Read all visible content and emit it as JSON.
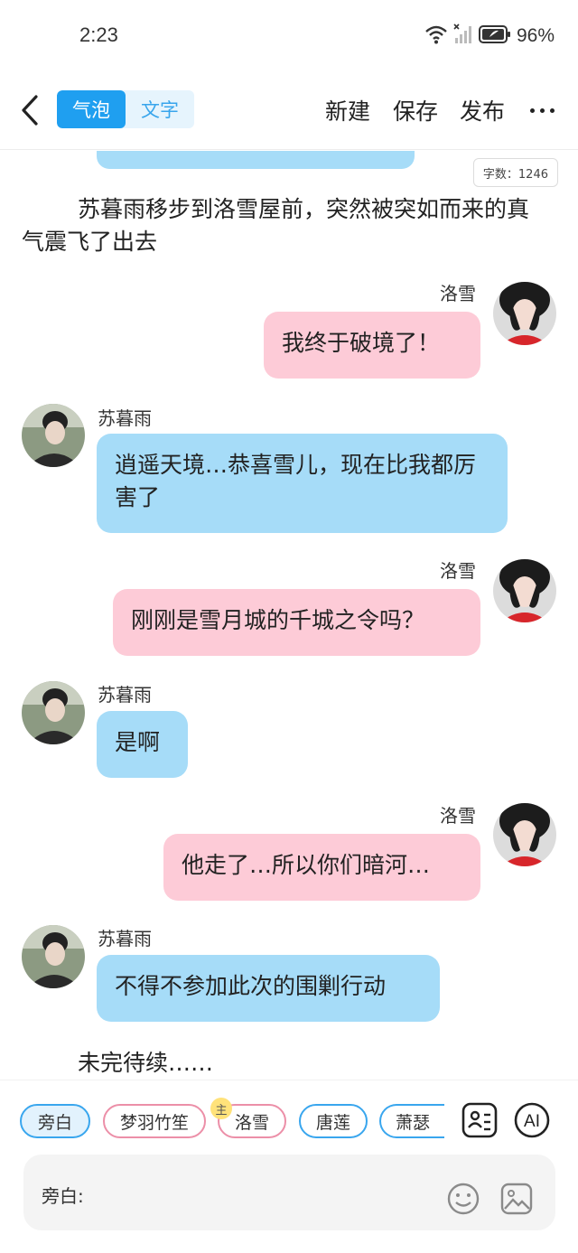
{
  "status_bar": {
    "time": "2:23",
    "battery": "96%"
  },
  "header": {
    "segments": [
      "气泡",
      "文字"
    ],
    "actions": {
      "new": "新建",
      "save": "保存",
      "publish": "发布"
    }
  },
  "chat": {
    "word_count": "字数：1246",
    "narration_1": "苏暮雨移步到洛雪屋前，突然被突如而来的真气震飞了出去",
    "messages": [
      {
        "speaker": "洛雪",
        "side": "right",
        "text": "我终于破境了！"
      },
      {
        "speaker": "苏暮雨",
        "side": "left",
        "text": "逍遥天境…恭喜雪儿，现在比我都厉害了"
      },
      {
        "speaker": "洛雪",
        "side": "right",
        "text": "刚刚是雪月城的千城之令吗？"
      },
      {
        "speaker": "苏暮雨",
        "side": "left",
        "text": "是啊"
      },
      {
        "speaker": "洛雪",
        "side": "right",
        "text": "他走了…所以你们暗河…"
      },
      {
        "speaker": "苏暮雨",
        "side": "left",
        "text": "不得不参加此次的围剿行动"
      }
    ],
    "narration_2": "未完待续……"
  },
  "bottom": {
    "roles": [
      "旁白",
      "梦羽竹笙",
      "洛雪",
      "唐莲",
      "萧瑟"
    ],
    "main_badge": "主",
    "ai_label": "AI",
    "input_label": "旁白:",
    "input_value": ""
  },
  "colors": {
    "accent": "#1f9ff0",
    "left_bubble": "#a6dcf8",
    "right_bubble": "#fdcbd7"
  }
}
